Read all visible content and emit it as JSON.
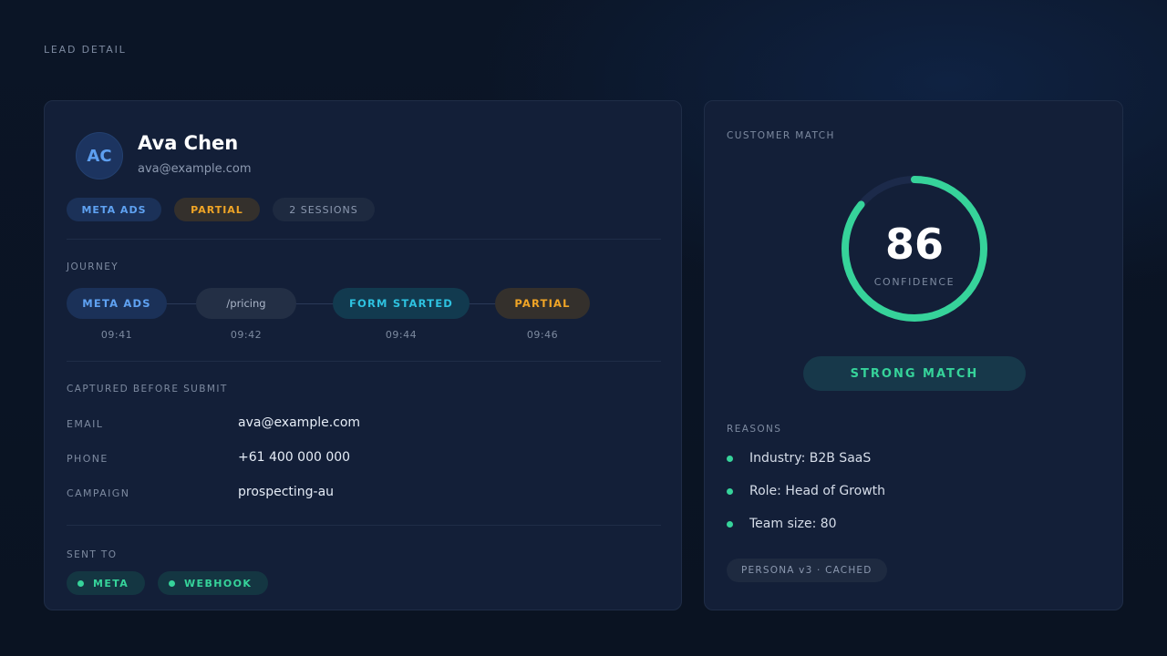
{
  "page": {
    "label": "LEAD DETAIL"
  },
  "lead": {
    "initials": "AC",
    "name": "Ava Chen",
    "email": "ava@example.com",
    "tags": [
      "META ADS",
      "PARTIAL",
      "2 SESSIONS"
    ]
  },
  "journey": {
    "label": "JOURNEY",
    "steps": [
      {
        "label": "META ADS",
        "time": "09:41"
      },
      {
        "label": "/pricing",
        "time": "09:42"
      },
      {
        "label": "FORM STARTED",
        "time": "09:44"
      },
      {
        "label": "PARTIAL",
        "time": "09:46"
      }
    ]
  },
  "captured": {
    "label": "CAPTURED BEFORE SUBMIT",
    "fields": [
      {
        "label": "EMAIL",
        "value": "ava@example.com"
      },
      {
        "label": "PHONE",
        "value": "+61 400 000 000"
      },
      {
        "label": "CAMPAIGN",
        "value": "prospecting-au"
      }
    ]
  },
  "sent_to": {
    "label": "SENT TO",
    "destinations": [
      "META",
      "WEBHOOK"
    ]
  },
  "customer_match": {
    "label": "CUSTOMER MATCH",
    "confidence": 86,
    "confidence_max": 100,
    "confidence_label": "CONFIDENCE",
    "status": "STRONG MATCH",
    "reasons_label": "REASONS",
    "reasons": [
      "Industry: B2B SaaS",
      "Role: Head of Growth",
      "Team size: 80"
    ],
    "footer_tag": "PERSONA v3 · CACHED"
  },
  "colors": {
    "accent_green": "#36d39a",
    "accent_blue": "#5fa2f2",
    "accent_orange": "#f0a526",
    "accent_teal": "#2ec2e0",
    "ring_track": "#1c2a4a"
  }
}
